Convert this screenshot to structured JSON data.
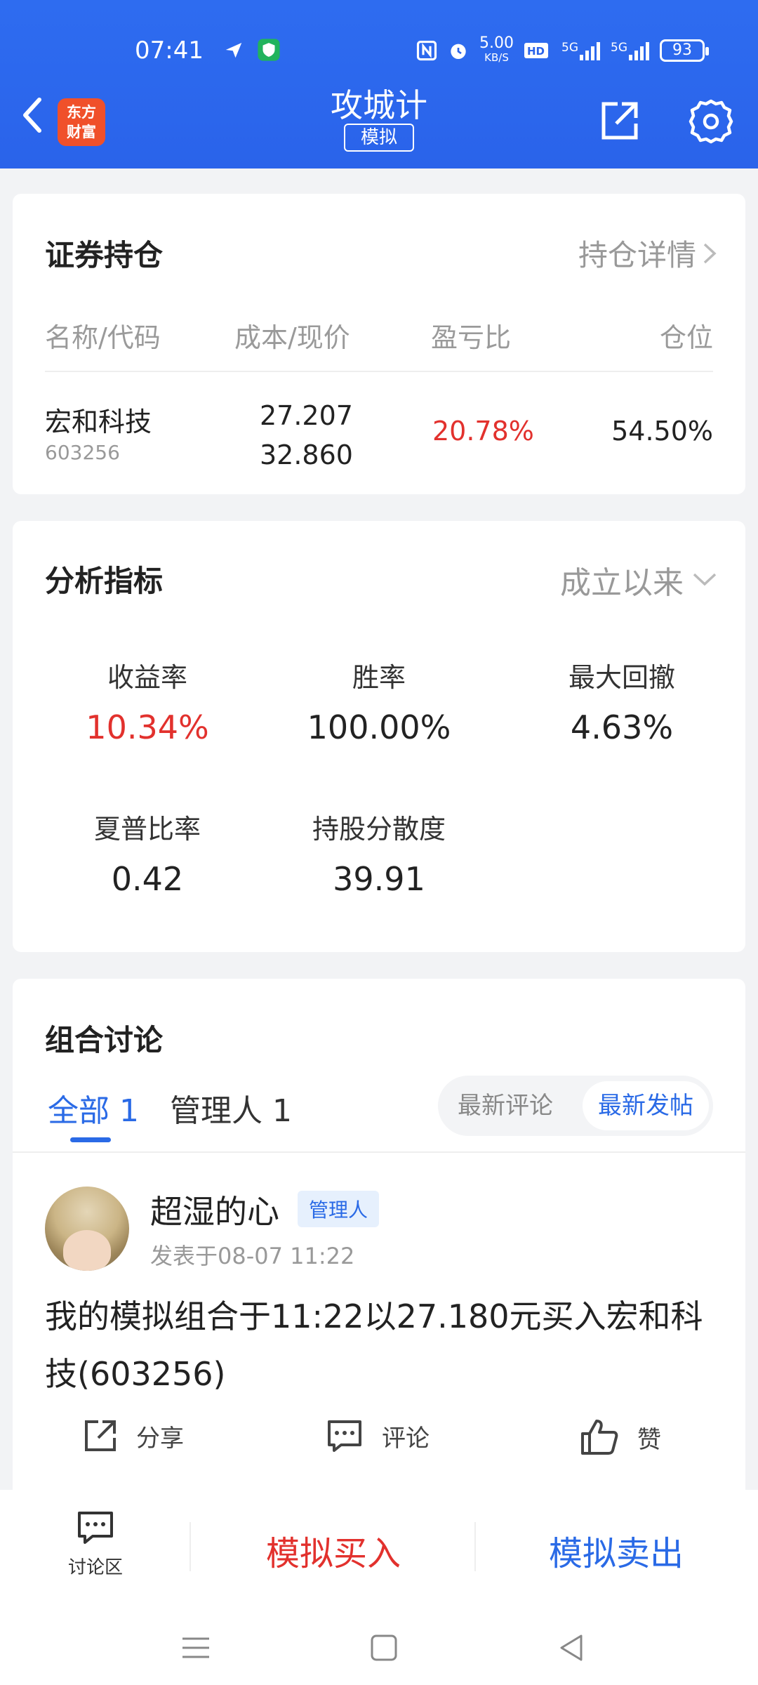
{
  "status_bar": {
    "time": "07:41",
    "net_speed_value": "5.00",
    "net_speed_unit": "KB/S",
    "signal_1": "5G",
    "signal_2": "5G",
    "battery": "93"
  },
  "header": {
    "logo_line1": "东方",
    "logo_line2": "财富",
    "title": "攻城计",
    "mode_tag": "模拟"
  },
  "holdings": {
    "title": "证券持仓",
    "details_link": "持仓详情",
    "columns": [
      "名称/代码",
      "成本/现价",
      "盈亏比",
      "仓位"
    ],
    "rows": [
      {
        "name": "宏和科技",
        "code": "603256",
        "cost": "27.207",
        "price": "32.860",
        "ratio": "20.78%",
        "position": "54.50%"
      }
    ]
  },
  "metrics": {
    "title": "分析指标",
    "period": "成立以来",
    "items": [
      {
        "label": "收益率",
        "value": "10.34%"
      },
      {
        "label": "胜率",
        "value": "100.00%"
      },
      {
        "label": "最大回撤",
        "value": "4.63%"
      },
      {
        "label": "夏普比率",
        "value": "0.42"
      },
      {
        "label": "持股分散度",
        "value": "39.91"
      }
    ]
  },
  "discussion": {
    "title": "组合讨论",
    "tabs": [
      "全部 1",
      "管理人 1"
    ],
    "sort_options": [
      "最新评论",
      "最新发帖"
    ],
    "post": {
      "author": "超湿的心",
      "badge": "管理人",
      "time": "发表于08-07 11:22",
      "content": "我的模拟组合于11:22以27.180元买入宏和科技(603256)",
      "actions": [
        "分享",
        "评论",
        "赞"
      ]
    }
  },
  "bottom": {
    "discuss_label": "讨论区",
    "buy_label": "模拟买入",
    "sell_label": "模拟卖出"
  },
  "colors": {
    "header_blue": "#2a63ea",
    "accent_blue": "#2a6ae6",
    "gain_red": "#e2312d",
    "logo_orange": "#f0502a"
  }
}
